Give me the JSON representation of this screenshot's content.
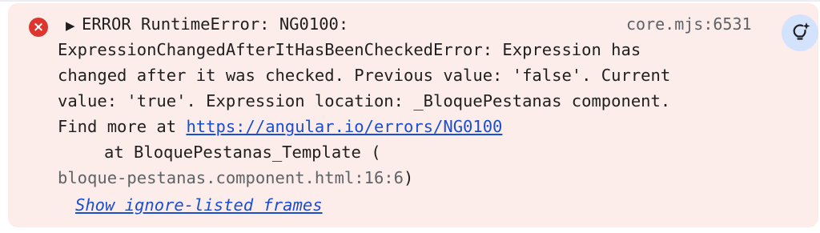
{
  "console": {
    "error_icon": "error-icon",
    "expand_icon": "triangle-right-icon",
    "source": "core.mjs:6531",
    "ai_icon": "lightbulb-sparkle-icon",
    "colors": {
      "panel_bg": "#fcecea",
      "error_red": "#dc362e",
      "link_blue": "#1a4ed1",
      "muted_gray": "#5f6368"
    },
    "message": {
      "line1": "ERROR RuntimeError: NG0100:",
      "line2": "ExpressionChangedAfterItHasBeenCheckedError: Expression has",
      "line3": "changed after it was checked. Previous value: 'false'. Current",
      "line4": "value: 'true'. Expression location: _BloquePestanas component.",
      "line5_prefix": "Find more at ",
      "url": "https://angular.io/errors/NG0100"
    },
    "stack": {
      "at_text": "at BloquePestanas_Template (",
      "source_location": "bloque-pestanas.component.html:16:6",
      "close_paren": ")"
    },
    "show_frames_label": "Show ignore-listed frames"
  }
}
